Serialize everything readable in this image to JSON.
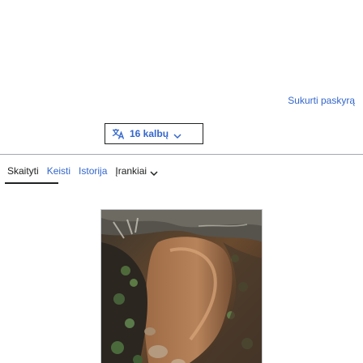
{
  "header": {
    "create_account": "Sukurti paskyrą"
  },
  "language": {
    "button_label": "16 kalbų"
  },
  "tabs": [
    {
      "label": "Skaityti"
    },
    {
      "label": "Keisti"
    },
    {
      "label": "Istorija"
    },
    {
      "label": "Įrankiai"
    }
  ],
  "colors": {
    "link": "#3366cc",
    "text": "#202122",
    "border": "#a2a9b1"
  },
  "icons": {
    "language": "translate-icon",
    "dropdown": "chevron-down-icon"
  }
}
